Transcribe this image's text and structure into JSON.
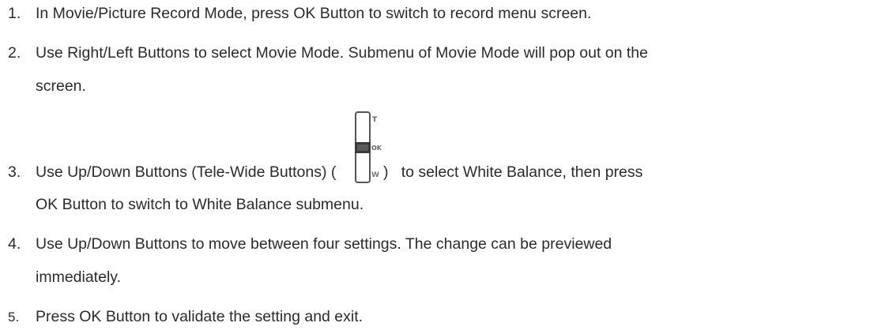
{
  "steps": [
    {
      "number": "1.",
      "lines": [
        "In Movie/Picture Record Mode, press OK Button to switch to record menu screen."
      ]
    },
    {
      "number": "2.",
      "lines": [
        "Use Right/Left Buttons to select Movie Mode. Submenu of Movie Mode will pop out on the",
        "screen."
      ]
    },
    {
      "number": "3.",
      "lines": [
        "Use Up/Down Buttons (Tele-Wide Buttons) (",
        ")   to select White Balance, then press",
        "OK Button to switch to White Balance submenu."
      ]
    },
    {
      "number": "4.",
      "lines": [
        "Use Up/Down Buttons to move between four settings. The change can be previewed",
        "immediately."
      ]
    },
    {
      "number": "5.",
      "lines": [
        "Press OK Button to validate the setting and exit."
      ]
    }
  ],
  "zoom_icon": {
    "name": "tele-wide-zoom-icon",
    "labels": {
      "top": "T",
      "middle": "OK",
      "bottom": "W"
    }
  }
}
